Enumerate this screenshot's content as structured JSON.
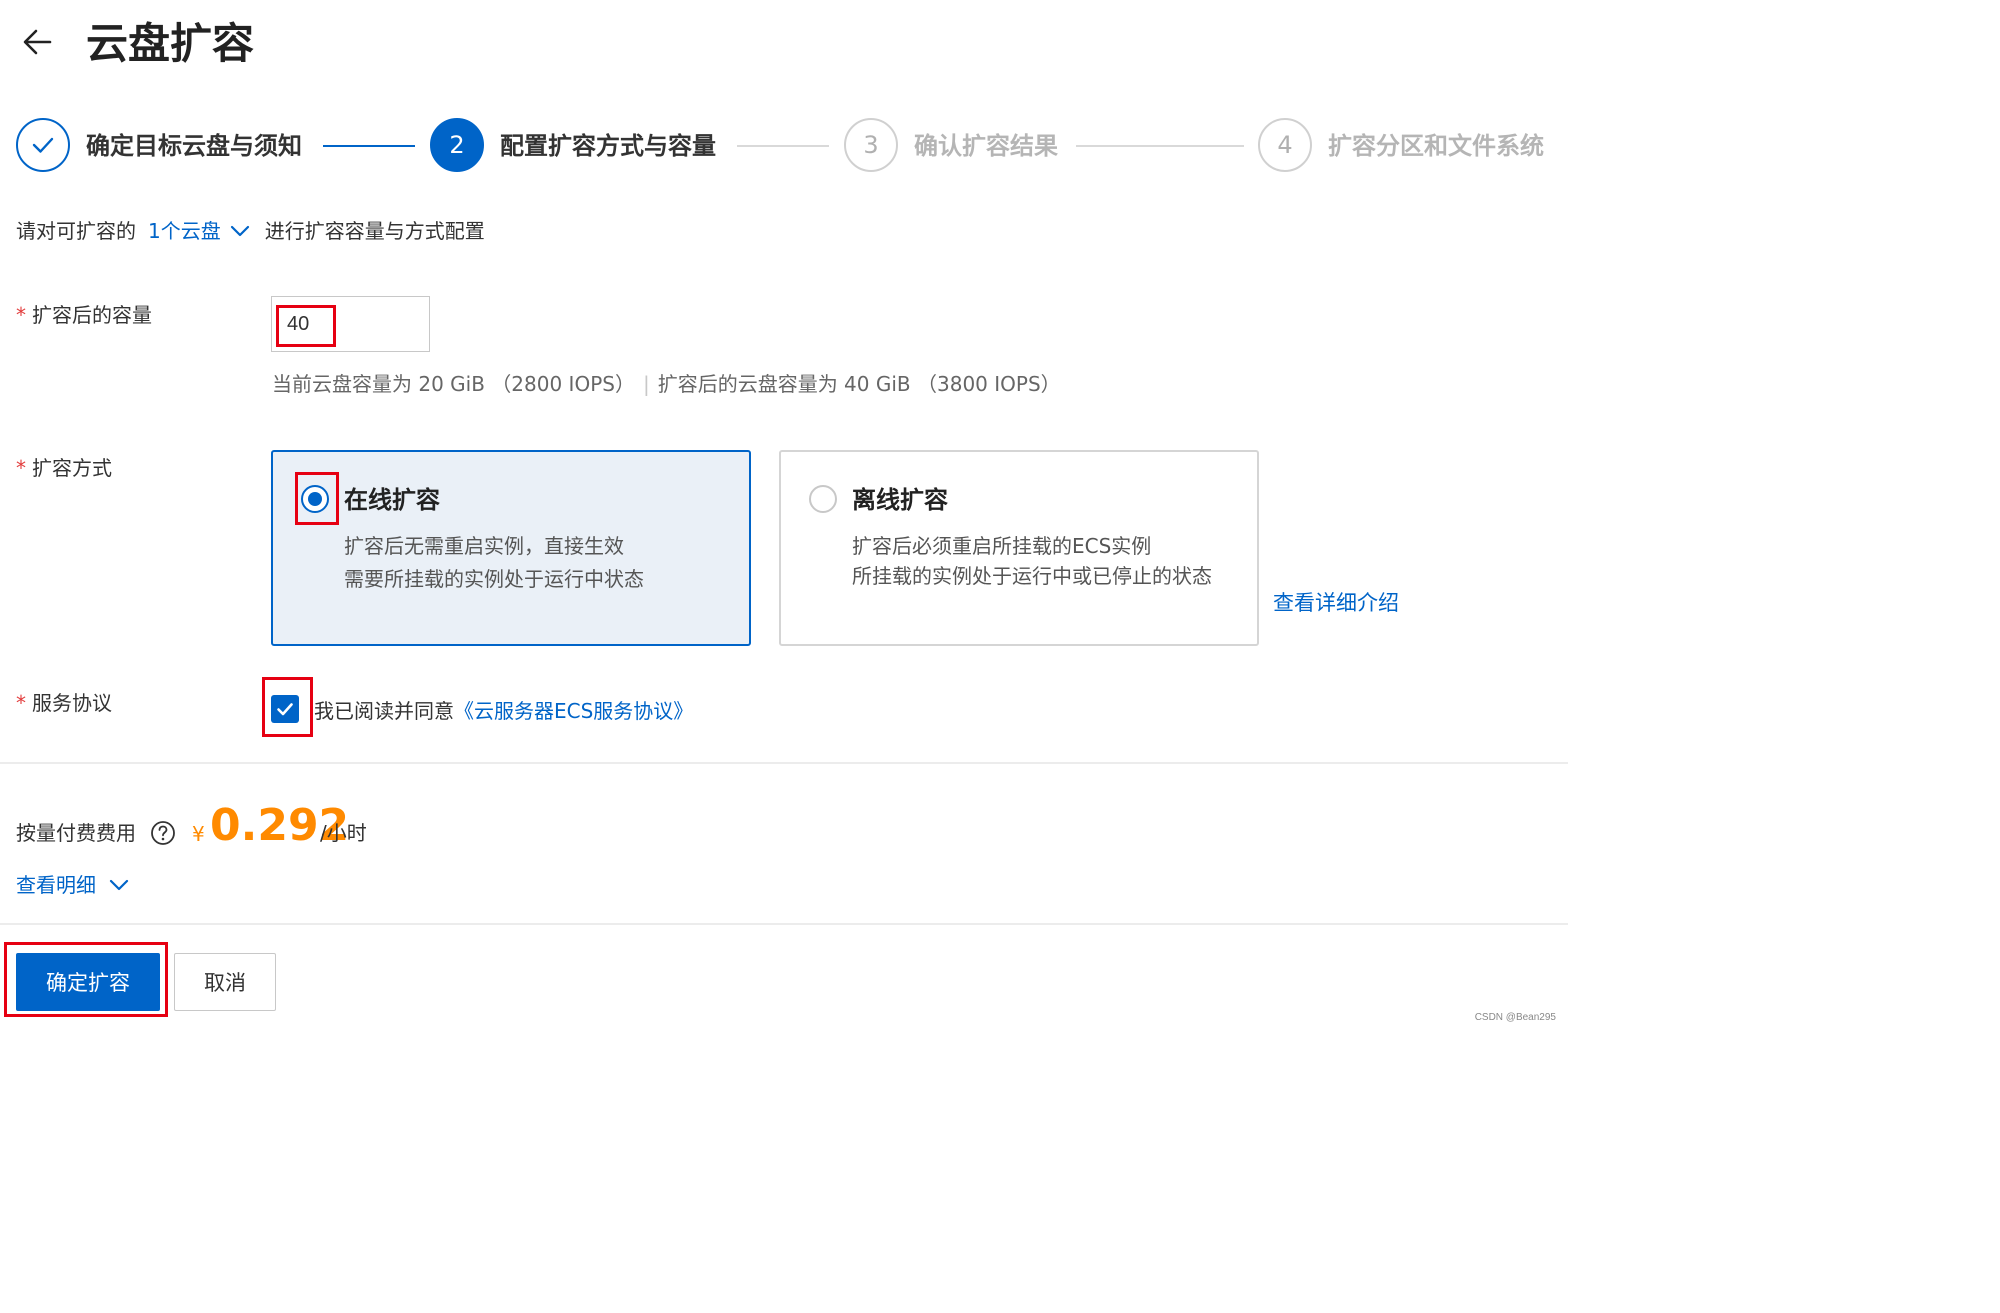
{
  "header": {
    "title": "云盘扩容",
    "back_icon": "arrow-left-icon"
  },
  "steps": [
    {
      "number": "",
      "label": "确定目标云盘与须知",
      "state": "done"
    },
    {
      "number": "2",
      "label": "配置扩容方式与容量",
      "state": "active"
    },
    {
      "number": "3",
      "label": "确认扩容结果",
      "state": "todo"
    },
    {
      "number": "4",
      "label": "扩容分区和文件系统",
      "state": "todo"
    }
  ],
  "intro": {
    "prefix": "请对可扩容的",
    "link": "1个云盘",
    "suffix": "进行扩容容量与方式配置"
  },
  "capacity": {
    "required": "*",
    "label": "扩容后的容量",
    "value": "40",
    "hint_current": "当前云盘容量为 20 GiB （2800 IOPS）",
    "hint_separator": "|",
    "hint_after": "扩容后的云盘容量为 40 GiB （3800 IOPS）"
  },
  "mode": {
    "required": "*",
    "label": "扩容方式",
    "options": [
      {
        "title": "在线扩容",
        "selected": true,
        "desc": [
          "扩容后无需重启实例，直接生效",
          "需要所挂载的实例处于运行中状态"
        ]
      },
      {
        "title": "离线扩容",
        "selected": false,
        "desc": [
          "扩容后必须重启所挂载的ECS实例",
          "所挂载的实例处于运行中或已停止的状态"
        ]
      }
    ],
    "detail_link": "查看详细介绍"
  },
  "agreement": {
    "required": "*",
    "label": "服务协议",
    "checked": true,
    "text": "我已阅读并同意",
    "link": "《云服务器ECS服务协议》"
  },
  "price": {
    "label": "按量付费费用",
    "currency": "¥",
    "value": "0.292",
    "unit": "/小时",
    "view_detail": "查看明细"
  },
  "actions": {
    "confirm": "确定扩容",
    "cancel": "取消"
  },
  "watermark": "CSDN @Bean295",
  "colors": {
    "primary": "#0064c8",
    "price": "#ff8a00",
    "required": "#e23d3d",
    "highlight": "#e60012"
  }
}
